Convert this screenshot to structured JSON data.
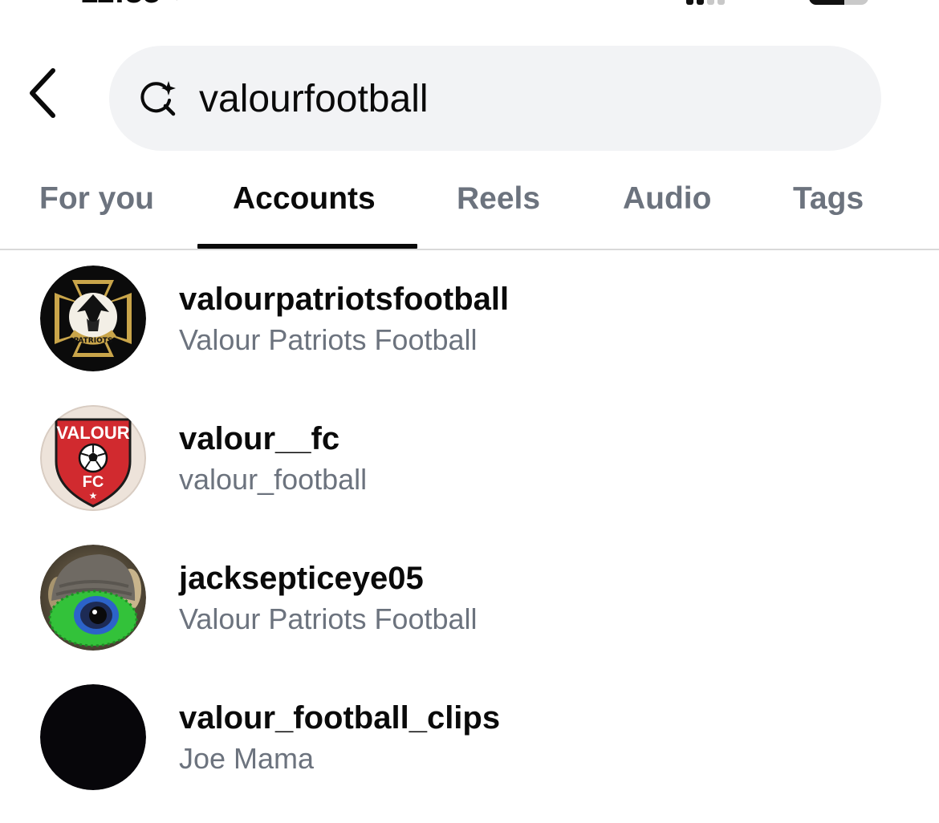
{
  "header": {
    "search_value": "valourfootball"
  },
  "tabs": [
    {
      "label": "For you",
      "active": false
    },
    {
      "label": "Accounts",
      "active": true
    },
    {
      "label": "Reels",
      "active": false
    },
    {
      "label": "Audio",
      "active": false
    },
    {
      "label": "Tags",
      "active": false
    }
  ],
  "results": [
    {
      "username": "valourpatriotsfootball",
      "full_name": "Valour Patriots Football",
      "avatar": "patriots-crest-avatar"
    },
    {
      "username": "valour__fc",
      "full_name": "valour_football",
      "avatar": "valour-fc-shield-avatar"
    },
    {
      "username": "jacksepticeye05",
      "full_name": "Valour Patriots Football",
      "avatar": "septic-eye-plush-avatar"
    },
    {
      "username": "valour_football_clips",
      "full_name": "Joe Mama",
      "avatar": "black-avatar"
    }
  ],
  "avatar_texts": {
    "patriots": "PATRIOTS",
    "valour_fc_top": "VALOUR",
    "valour_fc_bottom": "FC"
  },
  "colors": {
    "text_primary": "#0a0a0a",
    "text_secondary": "#6c737e",
    "search_bg": "#f2f3f5",
    "divider": "#d9d9d9",
    "valour_red": "#d12a2f",
    "patriots_gold": "#c9a54a"
  }
}
